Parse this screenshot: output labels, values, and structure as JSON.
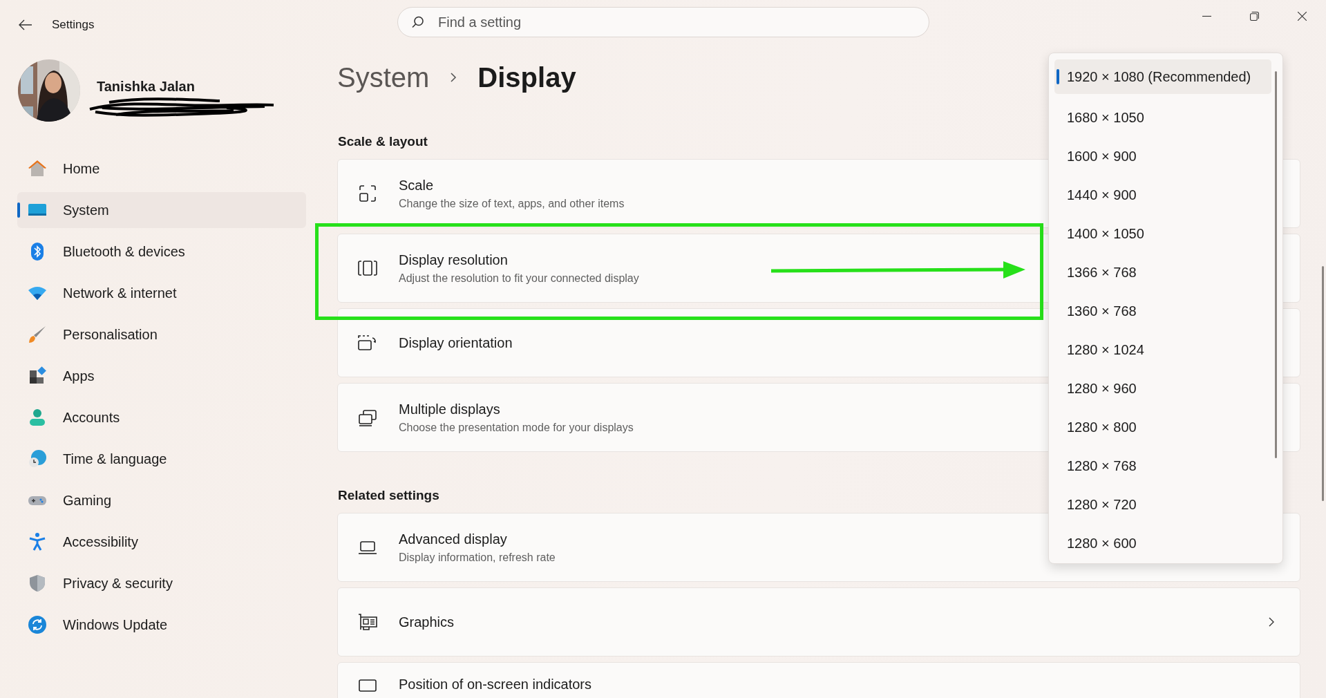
{
  "window": {
    "title": "Settings"
  },
  "search": {
    "placeholder": "Find a setting"
  },
  "user": {
    "name": "Tanishka Jalan"
  },
  "sidebar": {
    "items": [
      {
        "label": "Home",
        "kind": "home",
        "selected": false
      },
      {
        "label": "System",
        "kind": "system",
        "selected": true
      },
      {
        "label": "Bluetooth & devices",
        "kind": "bluetooth",
        "selected": false
      },
      {
        "label": "Network & internet",
        "kind": "network",
        "selected": false
      },
      {
        "label": "Personalisation",
        "kind": "brush",
        "selected": false
      },
      {
        "label": "Apps",
        "kind": "apps",
        "selected": false
      },
      {
        "label": "Accounts",
        "kind": "accounts",
        "selected": false
      },
      {
        "label": "Time & language",
        "kind": "time",
        "selected": false
      },
      {
        "label": "Gaming",
        "kind": "gaming",
        "selected": false
      },
      {
        "label": "Accessibility",
        "kind": "accessibility",
        "selected": false
      },
      {
        "label": "Privacy & security",
        "kind": "privacy",
        "selected": false
      },
      {
        "label": "Windows Update",
        "kind": "update",
        "selected": false
      }
    ]
  },
  "breadcrumb": {
    "parent": "System",
    "current": "Display"
  },
  "sections": [
    {
      "title": "Scale & layout",
      "rows": [
        {
          "title": "Scale",
          "subtitle": "Change the size of text, apps, and other items",
          "kind": "scale"
        },
        {
          "title": "Display resolution",
          "subtitle": "Adjust the resolution to fit your connected display",
          "kind": "resolution"
        },
        {
          "title": "Display orientation",
          "kind": "orientation"
        },
        {
          "title": "Multiple displays",
          "subtitle": "Choose the presentation mode for your displays",
          "kind": "multiple"
        }
      ]
    },
    {
      "title": "Related settings",
      "rows": [
        {
          "title": "Advanced display",
          "subtitle": "Display information, refresh rate",
          "kind": "laptop"
        },
        {
          "title": "Graphics",
          "kind": "graphics",
          "chevron": true
        },
        {
          "title": "Position of on-screen indicators",
          "kind": "position"
        }
      ]
    }
  ],
  "dropdown": {
    "options": [
      {
        "label": "1920 × 1080 (Recommended)",
        "selected": true
      },
      {
        "label": "1680 × 1050",
        "selected": false
      },
      {
        "label": "1600 × 900",
        "selected": false
      },
      {
        "label": "1440 × 900",
        "selected": false
      },
      {
        "label": "1400 × 1050",
        "selected": false
      },
      {
        "label": "1366 × 768",
        "selected": false
      },
      {
        "label": "1360 × 768",
        "selected": false
      },
      {
        "label": "1280 × 1024",
        "selected": false
      },
      {
        "label": "1280 × 960",
        "selected": false
      },
      {
        "label": "1280 × 800",
        "selected": false
      },
      {
        "label": "1280 × 768",
        "selected": false
      },
      {
        "label": "1280 × 720",
        "selected": false
      },
      {
        "label": "1280 × 600",
        "selected": false
      }
    ]
  }
}
